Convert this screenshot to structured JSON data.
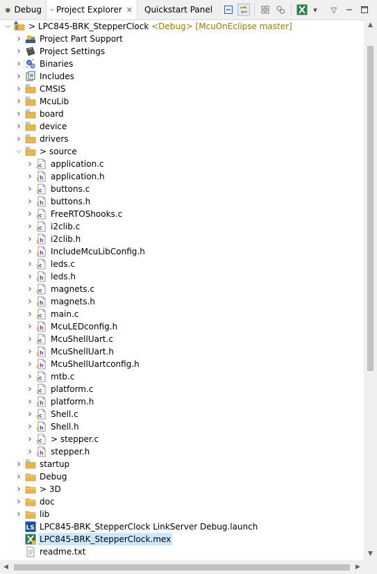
{
  "tabs": [
    {
      "label": "Debug",
      "icon": "debug-bug-icon"
    },
    {
      "label": "Project Explorer",
      "icon": "project-explorer-icon",
      "active": true
    },
    {
      "label": "Quickstart Panel",
      "icon": "quickstart-power-icon"
    }
  ],
  "toolbar": {
    "buttons": [
      "collapse-all-icon",
      "link-with-editor-icon",
      "filter-icon",
      "focus-icon",
      "mcu-config-tool-icon",
      "dropdown-icon",
      "view-menu-icon",
      "minimize-icon",
      "maximize-icon"
    ]
  },
  "tree": {
    "project": {
      "name": "LPC845-BRK_StepperClock",
      "prefix": ">",
      "decoration": "<Debug> [McuOnEclipse master]"
    },
    "children": [
      {
        "label": "Project Part Support",
        "icon": "part-support-icon"
      },
      {
        "label": "Project Settings",
        "icon": "settings-book-icon"
      },
      {
        "label": "Binaries",
        "icon": "binaries-icon"
      },
      {
        "label": "Includes",
        "icon": "includes-icon"
      },
      {
        "label": "CMSIS",
        "icon": "source-folder-icon"
      },
      {
        "label": "McuLib",
        "icon": "source-folder-icon"
      },
      {
        "label": "board",
        "icon": "source-folder-icon"
      },
      {
        "label": "device",
        "icon": "source-folder-icon"
      },
      {
        "label": "drivers",
        "icon": "source-folder-icon"
      },
      {
        "label": "source",
        "prefix": ">",
        "icon": "source-folder-icon",
        "expanded": true
      }
    ],
    "source_files": [
      {
        "label": "application.c",
        "icon": "c-file-icon"
      },
      {
        "label": "application.h",
        "icon": "h-file-icon"
      },
      {
        "label": "buttons.c",
        "icon": "c-file-icon"
      },
      {
        "label": "buttons.h",
        "icon": "h-file-icon"
      },
      {
        "label": "FreeRTOShooks.c",
        "icon": "c-file-icon"
      },
      {
        "label": "i2clib.c",
        "icon": "c-file-icon"
      },
      {
        "label": "i2clib.h",
        "icon": "h-file-icon"
      },
      {
        "label": "IncludeMcuLibConfig.h",
        "icon": "h-file-icon"
      },
      {
        "label": "leds.c",
        "icon": "c-file-icon"
      },
      {
        "label": "leds.h",
        "icon": "h-file-icon"
      },
      {
        "label": "magnets.c",
        "icon": "c-file-icon"
      },
      {
        "label": "magnets.h",
        "icon": "h-file-icon"
      },
      {
        "label": "main.c",
        "icon": "c-file-icon"
      },
      {
        "label": "McuLEDconfig.h",
        "icon": "h-file-icon"
      },
      {
        "label": "McuShellUart.c",
        "icon": "c-file-icon"
      },
      {
        "label": "McuShellUart.h",
        "icon": "h-file-icon"
      },
      {
        "label": "McuShellUartconfig.h",
        "icon": "h-file-icon"
      },
      {
        "label": "mtb.c",
        "icon": "c-file-icon"
      },
      {
        "label": "platform.c",
        "icon": "c-file-icon"
      },
      {
        "label": "platform.h",
        "icon": "h-file-icon"
      },
      {
        "label": "Shell.c",
        "icon": "c-file-icon"
      },
      {
        "label": "Shell.h",
        "icon": "h-file-icon"
      },
      {
        "label": "stepper.c",
        "prefix": ">",
        "icon": "c-file-icon"
      },
      {
        "label": "stepper.h",
        "icon": "h-file-icon"
      }
    ],
    "after": [
      {
        "label": "startup",
        "icon": "source-folder-icon",
        "chevron": true
      },
      {
        "label": "Debug",
        "icon": "folder-icon",
        "chevron": true
      },
      {
        "label": "3D",
        "prefix": ">",
        "icon": "folder-icon",
        "chevron": true
      },
      {
        "label": "doc",
        "icon": "folder-icon",
        "chevron": true
      },
      {
        "label": "lib",
        "icon": "folder-icon",
        "chevron": true
      },
      {
        "label": "LPC845-BRK_StepperClock LinkServer Debug.launch",
        "icon": "launch-config-icon",
        "chevron": false
      },
      {
        "label": "LPC845-BRK_StepperClock.mex",
        "icon": "mex-file-icon",
        "chevron": false,
        "selected": true
      },
      {
        "label": "readme.txt",
        "icon": "text-file-icon",
        "chevron": false
      }
    ]
  },
  "colors": {
    "selection": "#cce8ff",
    "decoration": "#9b7a00",
    "folder": "#e8b64a",
    "c_file_badge": "#2a5db0",
    "h_file_badge": "#6a3fb0"
  }
}
